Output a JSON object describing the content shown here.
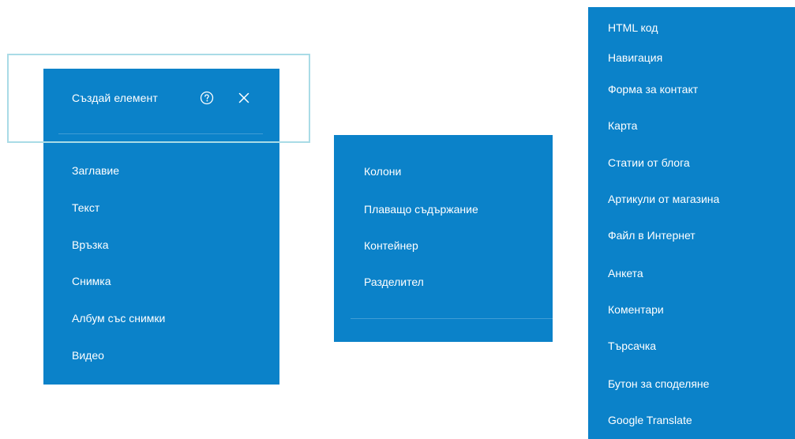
{
  "create_panel": {
    "title": "Създай елемент",
    "items": [
      {
        "label": "Заглавие"
      },
      {
        "label": "Текст"
      },
      {
        "label": "Връзка"
      },
      {
        "label": "Снимка"
      },
      {
        "label": "Албум със снимки"
      },
      {
        "label": "Видео"
      }
    ]
  },
  "layout_panel": {
    "items": [
      {
        "label": "Колони"
      },
      {
        "label": "Плаващо съдържание"
      },
      {
        "label": "Контейнер"
      },
      {
        "label": "Разделител"
      }
    ]
  },
  "advanced_panel": {
    "items": [
      {
        "label": "HTML код"
      },
      {
        "label": "Навигация"
      },
      {
        "label": "Форма за контакт"
      },
      {
        "label": "Карта"
      },
      {
        "label": "Статии от блога"
      },
      {
        "label": "Артикули от магазина"
      },
      {
        "label": "Файл в Интернет"
      },
      {
        "label": "Анкета"
      },
      {
        "label": "Коментари"
      },
      {
        "label": "Търсачка"
      },
      {
        "label": "Бутон за споделяне"
      },
      {
        "label": "Google Translate"
      }
    ]
  },
  "icons": {
    "help": "help-circle-icon",
    "close": "close-icon"
  },
  "colors": {
    "panel_background": "#0b82c9",
    "text": "#ffffff",
    "highlight_frame": "#a9dbe6"
  }
}
